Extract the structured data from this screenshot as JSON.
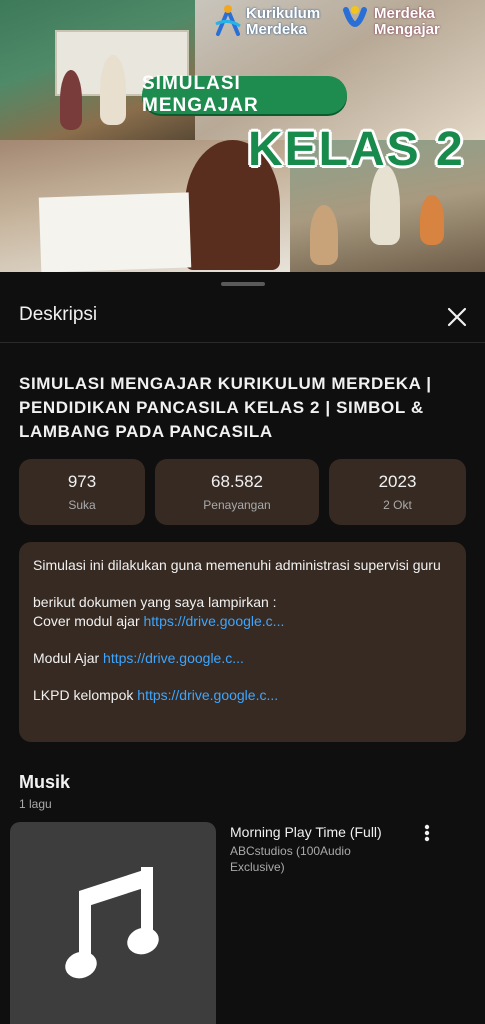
{
  "thumbnail": {
    "badge_text": "SIMULASI MENGAJAR",
    "big_text": "KELAS 2",
    "logo_left": "Kurikulum\nMerdeka",
    "logo_left_line1": "Kurikulum",
    "logo_left_line2": "Merdeka",
    "logo_right_line1": "Merdeka",
    "logo_right_line2": "Mengajar",
    "accent": "#1e8c4e"
  },
  "sheet": {
    "title": "Deskripsi",
    "close_icon": "close-icon"
  },
  "video": {
    "title": "SIMULASI MENGAJAR KURIKULUM MERDEKA | PENDIDIKAN PANCASILA KELAS 2 | SIMBOL & LAMBANG PADA PANCASILA"
  },
  "stats": [
    {
      "value": "973",
      "label": "Suka"
    },
    {
      "value": "68.582",
      "label": "Penayangan"
    },
    {
      "value": "2023",
      "label": "2 Okt"
    }
  ],
  "description": {
    "line1": "Simulasi ini dilakukan guna memenuhi administrasi supervisi guru",
    "line2": "berikut dokumen yang saya lampirkan :",
    "cover_label": "Cover modul ajar ",
    "cover_link": "https://drive.google.c...",
    "modul_label": "Modul Ajar ",
    "modul_link": "https://drive.google.c...",
    "lkpd_label": "LKPD kelompok ",
    "lkpd_link": "https://drive.google.c..."
  },
  "music": {
    "heading": "Musik",
    "count": "1 lagu",
    "song_title": "Morning Play Time (Full)",
    "song_artist": "ABCstudios (100Audio Exclusive)",
    "cover_icon": "music-note-icon",
    "more_icon": "more-vert-icon"
  }
}
